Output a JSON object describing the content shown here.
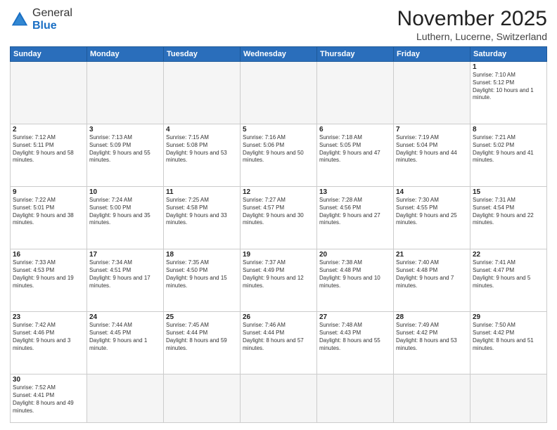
{
  "logo": {
    "general": "General",
    "blue": "Blue"
  },
  "title": "November 2025",
  "location": "Luthern, Lucerne, Switzerland",
  "weekdays": [
    "Sunday",
    "Monday",
    "Tuesday",
    "Wednesday",
    "Thursday",
    "Friday",
    "Saturday"
  ],
  "days": {
    "1": {
      "sunrise": "7:10 AM",
      "sunset": "5:12 PM",
      "daylight": "10 hours and 1 minute."
    },
    "2": {
      "sunrise": "7:12 AM",
      "sunset": "5:11 PM",
      "daylight": "9 hours and 58 minutes."
    },
    "3": {
      "sunrise": "7:13 AM",
      "sunset": "5:09 PM",
      "daylight": "9 hours and 55 minutes."
    },
    "4": {
      "sunrise": "7:15 AM",
      "sunset": "5:08 PM",
      "daylight": "9 hours and 53 minutes."
    },
    "5": {
      "sunrise": "7:16 AM",
      "sunset": "5:06 PM",
      "daylight": "9 hours and 50 minutes."
    },
    "6": {
      "sunrise": "7:18 AM",
      "sunset": "5:05 PM",
      "daylight": "9 hours and 47 minutes."
    },
    "7": {
      "sunrise": "7:19 AM",
      "sunset": "5:04 PM",
      "daylight": "9 hours and 44 minutes."
    },
    "8": {
      "sunrise": "7:21 AM",
      "sunset": "5:02 PM",
      "daylight": "9 hours and 41 minutes."
    },
    "9": {
      "sunrise": "7:22 AM",
      "sunset": "5:01 PM",
      "daylight": "9 hours and 38 minutes."
    },
    "10": {
      "sunrise": "7:24 AM",
      "sunset": "5:00 PM",
      "daylight": "9 hours and 35 minutes."
    },
    "11": {
      "sunrise": "7:25 AM",
      "sunset": "4:58 PM",
      "daylight": "9 hours and 33 minutes."
    },
    "12": {
      "sunrise": "7:27 AM",
      "sunset": "4:57 PM",
      "daylight": "9 hours and 30 minutes."
    },
    "13": {
      "sunrise": "7:28 AM",
      "sunset": "4:56 PM",
      "daylight": "9 hours and 27 minutes."
    },
    "14": {
      "sunrise": "7:30 AM",
      "sunset": "4:55 PM",
      "daylight": "9 hours and 25 minutes."
    },
    "15": {
      "sunrise": "7:31 AM",
      "sunset": "4:54 PM",
      "daylight": "9 hours and 22 minutes."
    },
    "16": {
      "sunrise": "7:33 AM",
      "sunset": "4:53 PM",
      "daylight": "9 hours and 19 minutes."
    },
    "17": {
      "sunrise": "7:34 AM",
      "sunset": "4:51 PM",
      "daylight": "9 hours and 17 minutes."
    },
    "18": {
      "sunrise": "7:35 AM",
      "sunset": "4:50 PM",
      "daylight": "9 hours and 15 minutes."
    },
    "19": {
      "sunrise": "7:37 AM",
      "sunset": "4:49 PM",
      "daylight": "9 hours and 12 minutes."
    },
    "20": {
      "sunrise": "7:38 AM",
      "sunset": "4:48 PM",
      "daylight": "9 hours and 10 minutes."
    },
    "21": {
      "sunrise": "7:40 AM",
      "sunset": "4:48 PM",
      "daylight": "9 hours and 7 minutes."
    },
    "22": {
      "sunrise": "7:41 AM",
      "sunset": "4:47 PM",
      "daylight": "9 hours and 5 minutes."
    },
    "23": {
      "sunrise": "7:42 AM",
      "sunset": "4:46 PM",
      "daylight": "9 hours and 3 minutes."
    },
    "24": {
      "sunrise": "7:44 AM",
      "sunset": "4:45 PM",
      "daylight": "9 hours and 1 minute."
    },
    "25": {
      "sunrise": "7:45 AM",
      "sunset": "4:44 PM",
      "daylight": "8 hours and 59 minutes."
    },
    "26": {
      "sunrise": "7:46 AM",
      "sunset": "4:44 PM",
      "daylight": "8 hours and 57 minutes."
    },
    "27": {
      "sunrise": "7:48 AM",
      "sunset": "4:43 PM",
      "daylight": "8 hours and 55 minutes."
    },
    "28": {
      "sunrise": "7:49 AM",
      "sunset": "4:42 PM",
      "daylight": "8 hours and 53 minutes."
    },
    "29": {
      "sunrise": "7:50 AM",
      "sunset": "4:42 PM",
      "daylight": "8 hours and 51 minutes."
    },
    "30": {
      "sunrise": "7:52 AM",
      "sunset": "4:41 PM",
      "daylight": "8 hours and 49 minutes."
    }
  }
}
